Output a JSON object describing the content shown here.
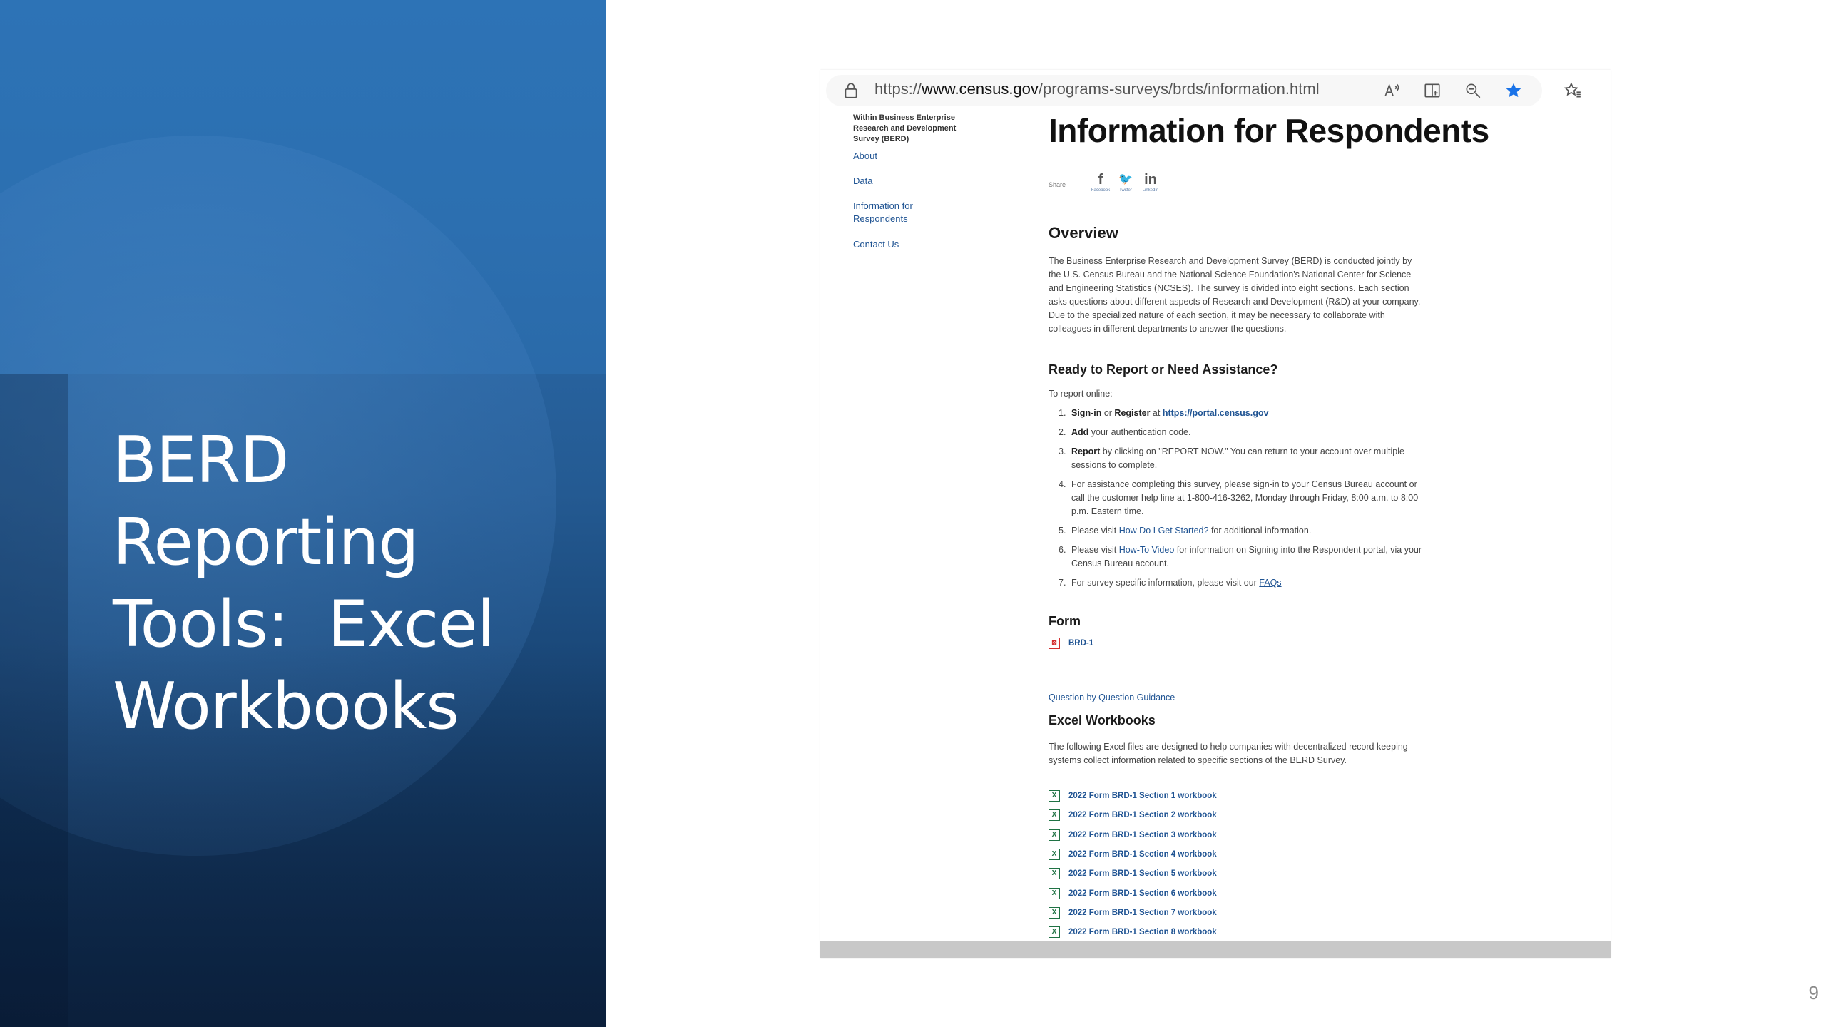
{
  "slide": {
    "title_lines": [
      "BERD",
      "Reporting",
      "Tools:  Excel",
      "Workbooks"
    ],
    "page_number": "9"
  },
  "browser": {
    "url_prefix": "https://",
    "url_host": "www.census.gov",
    "url_path": "/programs-surveys/brds/information.html"
  },
  "webpage": {
    "nav": {
      "heading": "Within Business Enterprise Research and Development Survey (BERD)",
      "items": [
        "About",
        "Data",
        "Information for Respondents",
        "Contact Us"
      ]
    },
    "title": "Information for Respondents",
    "share": {
      "label": "Share",
      "facebook": "f",
      "facebook_caption": "Facebook",
      "twitter": "🐦",
      "twitter_caption": "Twitter",
      "linkedin": "in",
      "linkedin_caption": "LinkedIn"
    },
    "overview_heading": "Overview",
    "overview_text": "The Business Enterprise Research and Development Survey (BERD) is conducted jointly by the U.S. Census Bureau and the National Science Foundation's National Center for Science and Engineering Statistics (NCSES). The survey is divided into eight sections. Each section asks questions about different aspects of Research and Development (R&D) at your company. Due to the specialized nature of each section, it may be necessary to collaborate with colleagues in different departments to answer the questions.",
    "ready_heading": "Ready to Report or Need Assistance?",
    "report_online": "To report online:",
    "steps": {
      "s1_bold1": "Sign-in",
      "s1_mid": " or ",
      "s1_bold2": "Register",
      "s1_at": " at ",
      "s1_link": "https://portal.census.gov",
      "s2_bold": "Add",
      "s2_rest": " your authentication code.",
      "s3_bold": "Report",
      "s3_rest": " by clicking on \"REPORT NOW.\"  You can return to your account over multiple sessions to complete.",
      "s4": "For assistance completing this survey, please sign-in to your Census Bureau account or call the customer help line at 1-800-416-3262, Monday through Friday, 8:00 a.m. to 8:00 p.m. Eastern time.",
      "s5_pre": "Please visit ",
      "s5_link": "How Do I Get Started?",
      "s5_post": " for additional information.",
      "s6_pre": "Please visit ",
      "s6_link": "How-To Video",
      "s6_post": " for information on Signing into the Respondent portal, via your Census Bureau account.",
      "s7_pre": "For survey specific information, please visit our ",
      "s7_link": "FAQs"
    },
    "form_heading": "Form",
    "form_link": "BRD-1",
    "guidance_link": "Question by Question Guidance",
    "excel_heading": "Excel Workbooks",
    "excel_text": "The following Excel files are designed to help companies with decentralized record keeping systems collect information related to specific sections of the BERD Survey.",
    "workbooks": [
      "2022 Form BRD-1 Section 1 workbook",
      "2022 Form BRD-1 Section 2 workbook",
      "2022 Form BRD-1 Section 3 workbook",
      "2022 Form BRD-1 Section 4 workbook",
      "2022 Form BRD-1 Section 5 workbook",
      "2022 Form BRD-1 Section 6 workbook",
      "2022 Form BRD-1 Section 7 workbook",
      "2022 Form BRD-1 Section 8 workbook"
    ]
  }
}
